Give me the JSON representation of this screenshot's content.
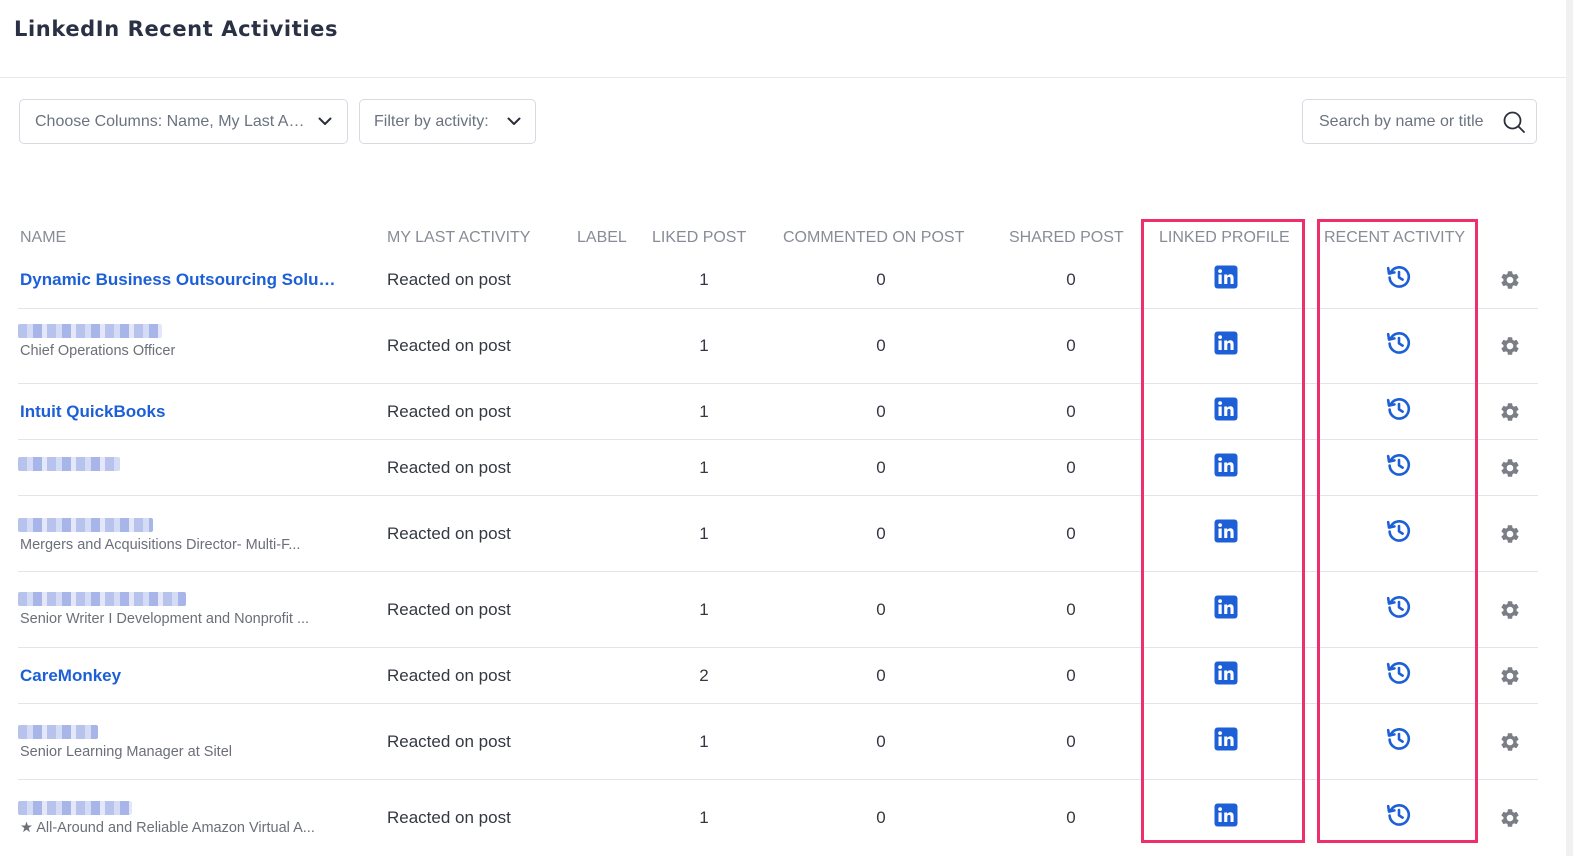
{
  "page": {
    "title": "LinkedIn Recent Activities"
  },
  "controls": {
    "columns_select": {
      "value": "Choose Columns: Name,  My Last Activity, Label, Liked Post"
    },
    "activity_filter": {
      "value": "Filter by activity:"
    },
    "search": {
      "placeholder": "Search by name or title"
    }
  },
  "table": {
    "headers": {
      "name": "NAME",
      "last_activity": "MY LAST ACTIVITY",
      "label": "LABEL",
      "liked": "LIKED POST",
      "commented": "COMMENTED ON POST",
      "shared": "SHARED POST",
      "linked_profile": "LINKED PROFILE",
      "recent_activity": "RECENT ACTIVITY"
    },
    "rows": [
      {
        "name": "Dynamic Business Outsourcing Solutions",
        "subtitle": "",
        "activity": "Reacted on post",
        "liked": "1",
        "commented": "0",
        "shared": "0"
      },
      {
        "name": "",
        "subtitle": "Chief Operations Officer",
        "activity": "Reacted on post",
        "liked": "1",
        "commented": "0",
        "shared": "0"
      },
      {
        "name": "Intuit QuickBooks",
        "subtitle": "",
        "activity": "Reacted on post",
        "liked": "1",
        "commented": "0",
        "shared": "0"
      },
      {
        "name": "",
        "subtitle": "",
        "activity": "Reacted on post",
        "liked": "1",
        "commented": "0",
        "shared": "0"
      },
      {
        "name": "",
        "subtitle": "Mergers and Acquisitions Director- Multi-F...",
        "activity": "Reacted on post",
        "liked": "1",
        "commented": "0",
        "shared": "0"
      },
      {
        "name": "",
        "subtitle": "Senior Writer I Development and Nonprofit ...",
        "activity": "Reacted on post",
        "liked": "1",
        "commented": "0",
        "shared": "0"
      },
      {
        "name": "CareMonkey",
        "subtitle": "",
        "activity": "Reacted on post",
        "liked": "2",
        "commented": "0",
        "shared": "0"
      },
      {
        "name": "",
        "subtitle": "Senior Learning Manager at Sitel",
        "activity": "Reacted on post",
        "liked": "1",
        "commented": "0",
        "shared": "0"
      },
      {
        "name": "",
        "subtitle": "★ All-Around and Reliable Amazon Virtual A...",
        "activity": "Reacted on post",
        "liked": "1",
        "commented": "0",
        "shared": "0"
      }
    ]
  },
  "icons": {
    "chevron": "chevron-down-icon",
    "search": "search-icon",
    "linkedin": "linkedin-icon",
    "history": "history-icon",
    "settings": "gear-icon"
  },
  "colors": {
    "link": "#1c5fd6",
    "highlight": "#ee2f6b",
    "gear": "#7a7e86"
  }
}
